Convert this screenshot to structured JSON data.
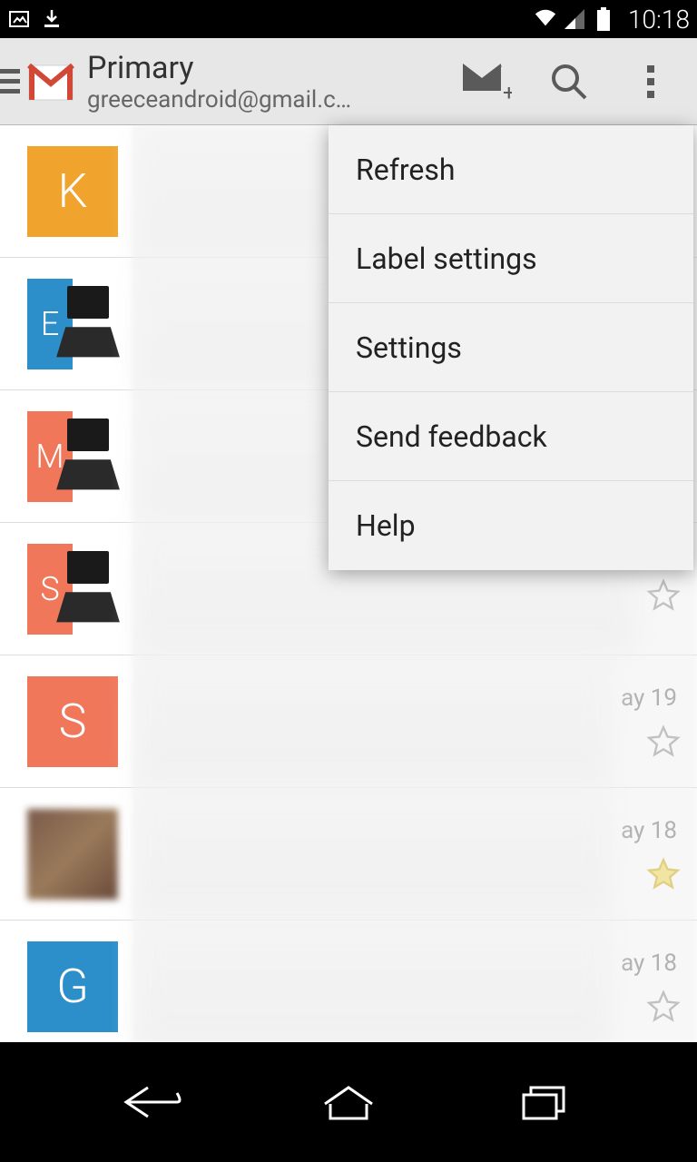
{
  "status": {
    "time": "10:18"
  },
  "header": {
    "title": "Primary",
    "subtitle": "greeceandroid@gmail.c…"
  },
  "menu": {
    "items": [
      {
        "label": "Refresh"
      },
      {
        "label": "Label settings"
      },
      {
        "label": "Settings"
      },
      {
        "label": "Send feedback"
      },
      {
        "label": "Help"
      }
    ]
  },
  "emails": [
    {
      "initial": "K",
      "color": "#f0a42e",
      "type": "letter",
      "date": "",
      "starred": false,
      "star_visible": false
    },
    {
      "initial": "E",
      "color": "#2c8fc9",
      "type": "laptop",
      "date": "",
      "starred": false,
      "star_visible": false
    },
    {
      "initial": "M",
      "color": "#f0775a",
      "type": "laptop",
      "date": "",
      "starred": false,
      "star_visible": false
    },
    {
      "initial": "S",
      "color": "#f0775a",
      "type": "laptop",
      "date": "",
      "starred": false,
      "star_visible": true
    },
    {
      "initial": "S",
      "color": "#f0775a",
      "type": "letter",
      "date": "ay 19",
      "starred": false,
      "star_visible": true
    },
    {
      "initial": "",
      "color": "",
      "type": "photo",
      "date": "ay 18",
      "starred": true,
      "star_visible": true
    },
    {
      "initial": "G",
      "color": "#2c8fc9",
      "type": "letter",
      "date": "ay 18",
      "starred": false,
      "star_visible": true
    }
  ]
}
